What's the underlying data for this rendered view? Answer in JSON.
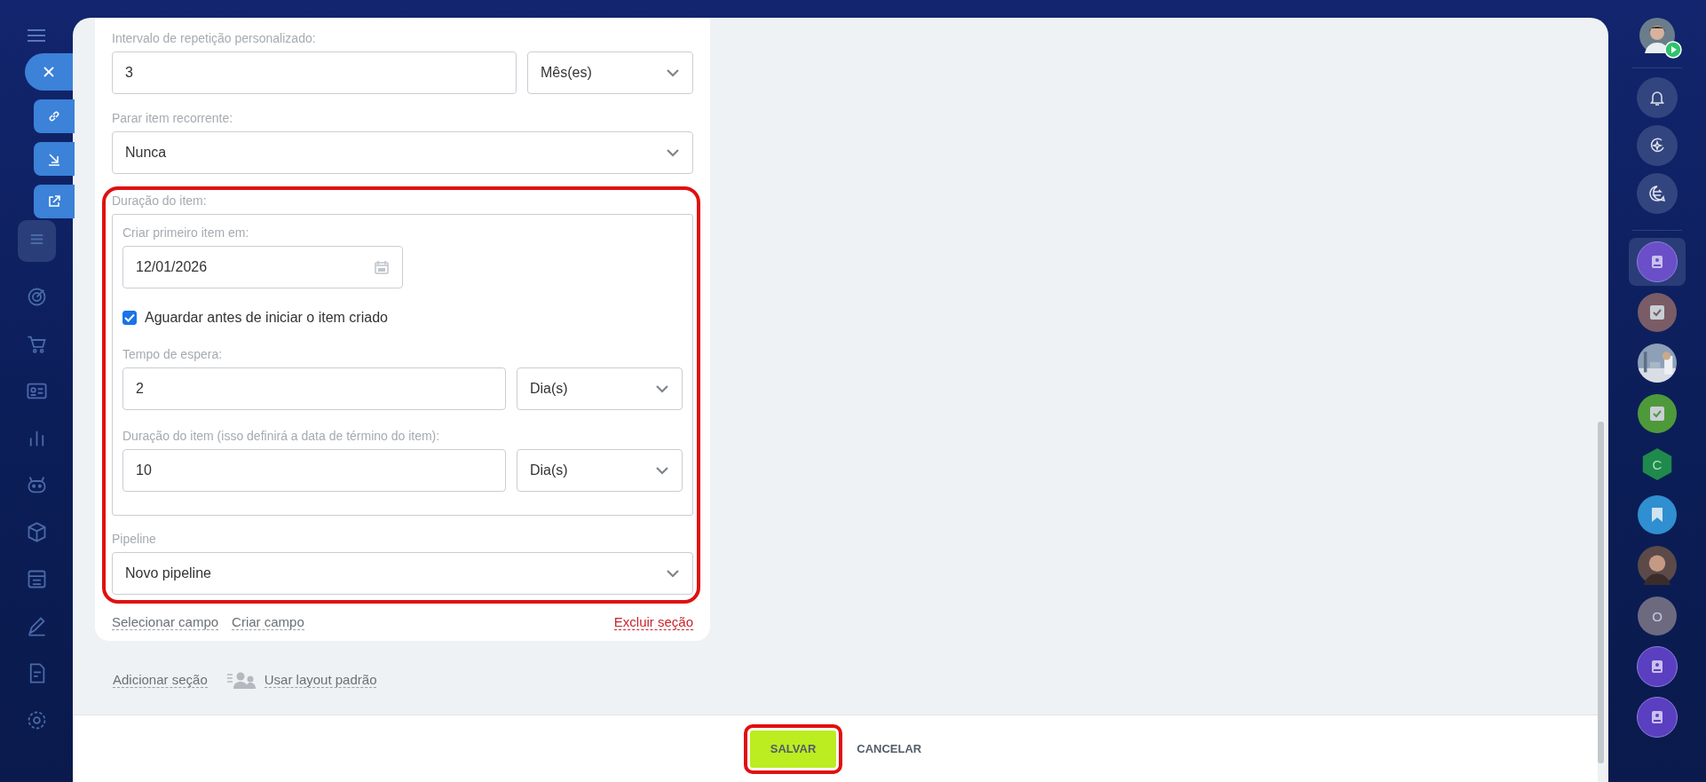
{
  "form": {
    "fields": [
      {
        "kind": "number_unit",
        "label": "Intervalo de repetição personalizado:",
        "value": "3",
        "unit": "Mês(es)"
      },
      {
        "kind": "select",
        "label": "Parar item recorrente:",
        "value": "Nunca"
      }
    ],
    "duration_group": {
      "label": "Duração do item:",
      "date_label": "Criar primeiro item em:",
      "date_value": "12/01/2026",
      "wait_checkbox": {
        "label": "Aguardar antes de iniciar o item criado",
        "checked": true
      },
      "fields": [
        {
          "label": "Tempo de espera:",
          "value": "2",
          "unit": "Dia(s)"
        },
        {
          "label": "Duração do item (isso definirá a data de término do item):",
          "value": "10",
          "unit": "Dia(s)"
        }
      ]
    },
    "pipeline": {
      "label": "Pipeline",
      "value": "Novo pipeline"
    },
    "links": [
      {
        "label": "Selecionar campo",
        "kind": "normal"
      },
      {
        "label": "Criar campo",
        "kind": "normal"
      },
      {
        "label": "Excluir seção",
        "kind": "danger"
      }
    ]
  },
  "section_actions": [
    {
      "label": "Adicionar seção",
      "kind": "plain"
    },
    {
      "label": "Usar layout padrão",
      "kind": "layout"
    }
  ],
  "footer": {
    "buttons": [
      {
        "label": "SALVAR",
        "kind": "primary"
      },
      {
        "label": "CANCELAR",
        "kind": "secondary"
      }
    ]
  },
  "right_bar": {
    "items": [
      {
        "kind": "contact",
        "color": "#6a4fc8",
        "selected": true
      },
      {
        "kind": "task",
        "color": "#7a5c66",
        "selected": false
      },
      {
        "kind": "picture",
        "selected": false
      },
      {
        "kind": "task",
        "color": "#4e9a3a",
        "selected": false
      },
      {
        "kind": "hexagon",
        "letter": "C",
        "color": "#1f8a4c",
        "selected": false
      },
      {
        "kind": "bookmark",
        "color": "#2f8fd0",
        "selected": false
      },
      {
        "kind": "person",
        "selected": false
      },
      {
        "kind": "letter",
        "letter": "O",
        "color": "#6d6a80",
        "selected": false
      },
      {
        "kind": "contact",
        "color": "#5a3fc0",
        "selected": false
      },
      {
        "kind": "contact",
        "color": "#5a3fc0",
        "selected": false
      }
    ]
  }
}
